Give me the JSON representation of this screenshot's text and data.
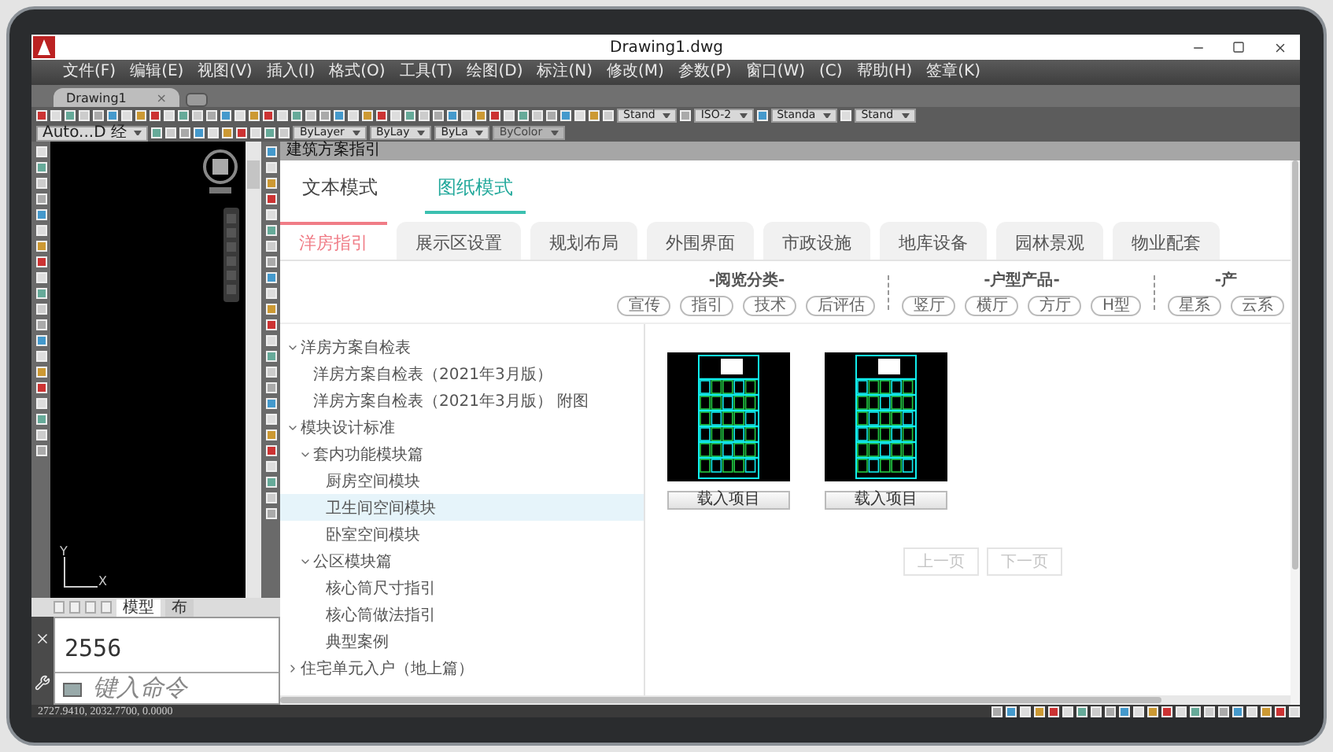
{
  "window": {
    "title": "Drawing1.dwg"
  },
  "menu": [
    "文件(F)",
    "编辑(E)",
    "视图(V)",
    "插入(I)",
    "格式(O)",
    "工具(T)",
    "绘图(D)",
    "标注(N)",
    "修改(M)",
    "参数(P)",
    "窗口(W)",
    "(C)",
    "帮助(H)",
    "签章(K)"
  ],
  "doc_tabs": [
    {
      "label": "Drawing1",
      "close": "×",
      "selected": true
    }
  ],
  "toolbar": {
    "style_dropdowns": [
      "Stand",
      "ISO-2",
      "Standa",
      "Stand"
    ],
    "workspace": "Auto...D 经",
    "layer": "ByLayer",
    "linetype": "ByLay",
    "lineweight": "ByLa",
    "plot_style": "ByColor"
  },
  "canvas": {
    "ucs": {
      "x": "X",
      "y": "Y"
    },
    "layout_tabs": [
      {
        "label": "模型",
        "selected": true
      },
      {
        "label": "布",
        "selected": false
      }
    ]
  },
  "command": {
    "history": "2556",
    "placeholder": "键入命令"
  },
  "status_bar": {
    "coordinates": "2727.9410, 2032.7700, 0.0000"
  },
  "panel": {
    "title": "建筑方案指引",
    "modes": [
      {
        "label": "文本模式",
        "selected": false
      },
      {
        "label": "图纸模式",
        "selected": true
      }
    ],
    "categories": [
      {
        "label": "洋房指引",
        "selected": true
      },
      {
        "label": "展示区设置",
        "selected": false
      },
      {
        "label": "规划布局",
        "selected": false
      },
      {
        "label": "外围界面",
        "selected": false
      },
      {
        "label": "市政设施",
        "selected": false
      },
      {
        "label": "地库设备",
        "selected": false
      },
      {
        "label": "园林景观",
        "selected": false
      },
      {
        "label": "物业配套",
        "selected": false
      }
    ],
    "filters": [
      {
        "title": "-阅览分类-",
        "chips": [
          "宣传",
          "指引",
          "技术",
          "后评估"
        ]
      },
      {
        "title": "-户型产品-",
        "chips": [
          "竖厅",
          "横厅",
          "方厅",
          "H型"
        ]
      },
      {
        "title": "-产",
        "chips": [
          "星系",
          "云系"
        ]
      }
    ],
    "tree": [
      {
        "label": "洋房方案自检表",
        "expanded": true,
        "selected": false,
        "children": [
          {
            "label": "洋房方案自检表（2021年3月版）",
            "selected": false
          },
          {
            "label": "洋房方案自检表（2021年3月版） 附图",
            "selected": false
          }
        ]
      },
      {
        "label": "模块设计标准",
        "expanded": true,
        "selected": false,
        "children": [
          {
            "label": "套内功能模块篇",
            "expanded": true,
            "selected": false,
            "children": [
              {
                "label": "厨房空间模块",
                "selected": false
              },
              {
                "label": "卫生间空间模块",
                "selected": true
              },
              {
                "label": "卧室空间模块",
                "selected": false
              }
            ]
          },
          {
            "label": "公区模块篇",
            "expanded": true,
            "selected": false,
            "children": [
              {
                "label": "核心筒尺寸指引",
                "selected": false
              },
              {
                "label": "核心筒做法指引",
                "selected": false
              },
              {
                "label": "典型案例",
                "selected": false
              }
            ]
          }
        ]
      },
      {
        "label": "住宅单元入户（地上篇）",
        "expanded": false,
        "selected": false
      }
    ],
    "drawings": [
      {
        "button": "载入项目"
      },
      {
        "button": "载入项目"
      }
    ],
    "pagination": [
      {
        "label": "上一页",
        "disabled": true
      },
      {
        "label": "下一页",
        "disabled": true
      }
    ]
  }
}
